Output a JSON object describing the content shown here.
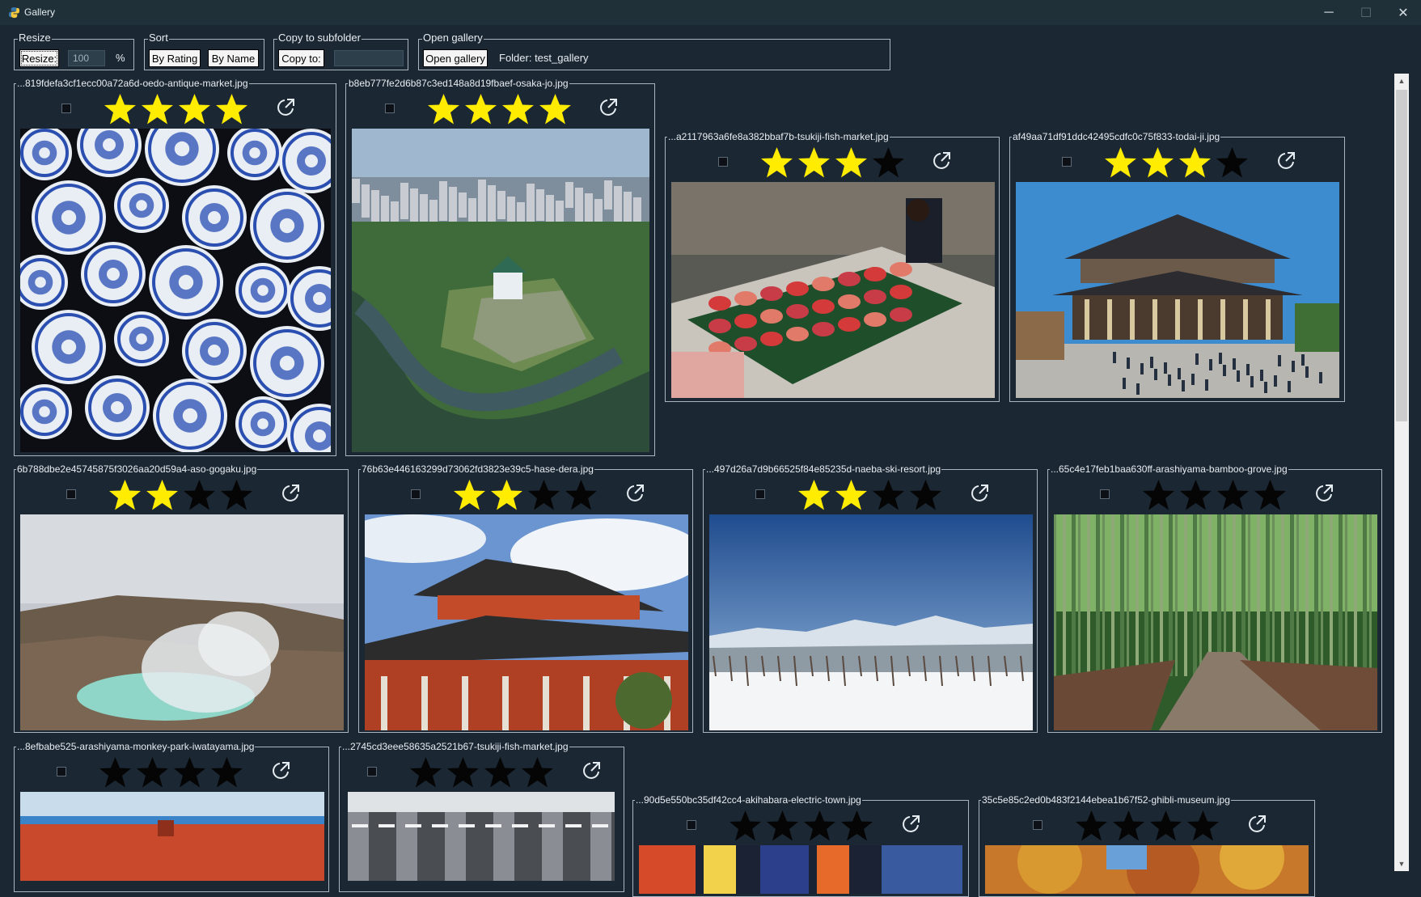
{
  "window": {
    "title": "Gallery",
    "minimize": "─",
    "maximize": "☐",
    "close": "✕"
  },
  "toolbar": {
    "resize": {
      "legend": "Resize",
      "button": "Resize:",
      "value": "100",
      "unit": "%"
    },
    "sort": {
      "legend": "Sort",
      "by_rating": "By Rating",
      "by_name": "By Name"
    },
    "copy": {
      "legend": "Copy to subfolder",
      "button": "Copy to:",
      "value": ""
    },
    "open": {
      "legend": "Open gallery",
      "button": "Open gallery",
      "folder_label": "Folder: test_gallery"
    }
  },
  "colors": {
    "star_on": "#ffec00",
    "star_off": "#050505",
    "background": "#1b2733"
  },
  "images": [
    {
      "filename": "...819fdefa3cf1ecc00a72a6d-oedo-antique-market.jpg",
      "rating": 4,
      "selected": false
    },
    {
      "filename": "b8eb777fe2d6b87c3ed148a8d19fbaef-osaka-jo.jpg",
      "rating": 4,
      "selected": false
    },
    {
      "filename": "...a2117963a6fe8a382bbaf7b-tsukiji-fish-market.jpg",
      "rating": 3,
      "selected": false
    },
    {
      "filename": "af49aa71df91ddc42495cdfc0c75f833-todai-ji.jpg",
      "rating": 3,
      "selected": false
    },
    {
      "filename": "6b788dbe2e45745875f3026aa20d59a4-aso-gogaku.jpg",
      "rating": 2,
      "selected": false
    },
    {
      "filename": "76b63e446163299d73062fd3823e39c5-hase-dera.jpg",
      "rating": 2,
      "selected": false
    },
    {
      "filename": "...497d26a7d9b66525f84e85235d-naeba-ski-resort.jpg",
      "rating": 2,
      "selected": false
    },
    {
      "filename": "...65c4e17feb1baa630ff-arashiyama-bamboo-grove.jpg",
      "rating": 0,
      "selected": false
    },
    {
      "filename": "...8efbabe525-arashiyama-monkey-park-iwatayama.jpg",
      "rating": 0,
      "selected": false
    },
    {
      "filename": "...2745cd3eee58635a2521b67-tsukiji-fish-market.jpg",
      "rating": 0,
      "selected": false
    },
    {
      "filename": "...90d5e550bc35df42cc4-akihabara-electric-town.jpg",
      "rating": 0,
      "selected": false
    },
    {
      "filename": "35c5e85c2ed0b483f2144ebea1b67f52-ghibli-museum.jpg",
      "rating": 0,
      "selected": false
    }
  ]
}
